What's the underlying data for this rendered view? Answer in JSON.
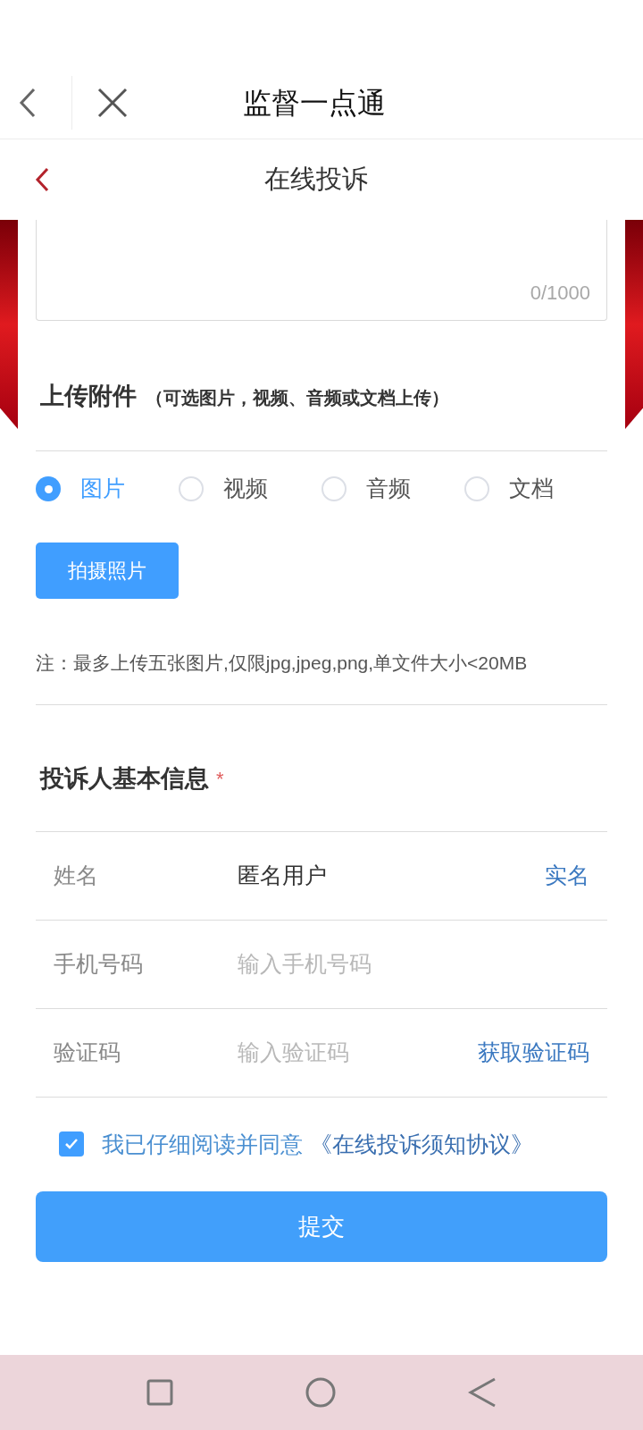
{
  "header": {
    "title": "监督一点通"
  },
  "subheader": {
    "title": "在线投诉"
  },
  "description": {
    "counter": "0/1000"
  },
  "attachments": {
    "title": "上传附件",
    "hint": "（可选图片，视频、音频或文档上传）",
    "types": [
      {
        "label": "图片",
        "selected": true
      },
      {
        "label": "视频",
        "selected": false
      },
      {
        "label": "音频",
        "selected": false
      },
      {
        "label": "文档",
        "selected": false
      }
    ],
    "button": "拍摄照片",
    "note": "注：最多上传五张图片,仅限jpg,jpeg,png,单文件大小<20MB"
  },
  "complainant": {
    "title": "投诉人基本信息",
    "required_mark": "*",
    "fields": [
      {
        "label": "姓名",
        "value": "匿名用户",
        "action": "实名"
      },
      {
        "label": "手机号码",
        "placeholder": "输入手机号码"
      },
      {
        "label": "验证码",
        "placeholder": "输入验证码",
        "action": "获取验证码"
      }
    ]
  },
  "agreement": {
    "checked": true,
    "text": "我已仔细阅读并同意",
    "link": "《在线投诉须知协议》"
  },
  "submit": "提交"
}
